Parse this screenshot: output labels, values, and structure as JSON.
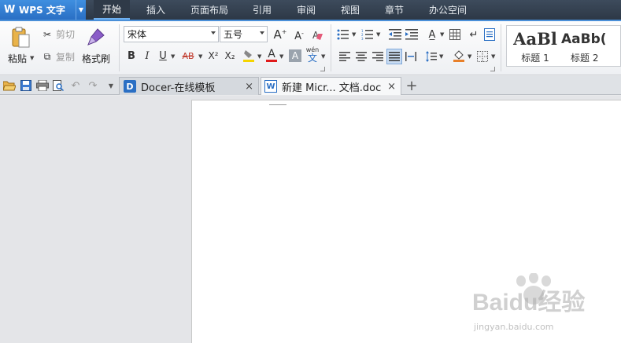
{
  "app": {
    "name": "WPS 文字"
  },
  "menu": {
    "tabs": [
      "开始",
      "插入",
      "页面布局",
      "引用",
      "审阅",
      "视图",
      "章节",
      "办公空间"
    ],
    "active": "开始"
  },
  "ribbon": {
    "paste": "粘贴",
    "cut": "剪切",
    "copy": "复制",
    "format_painter": "格式刷",
    "font_name": "宋体",
    "font_size": "五号",
    "bold": "B",
    "italic": "I",
    "underline": "U",
    "strikethrough": "AB",
    "superscript": "X²",
    "subscript": "X₂",
    "font_color": "A",
    "char_shading": "A",
    "phonetic": "wén",
    "grow_font": "A",
    "shrink_font": "A",
    "styles": [
      {
        "preview": "AaBl",
        "label": "标题 1"
      },
      {
        "preview": "AaBb(",
        "label": "标题 2"
      }
    ]
  },
  "tabs": {
    "docer": "Docer-在线模板",
    "document": "新建 Micr... 文档.doc",
    "close": "×",
    "new": "+"
  },
  "watermark": {
    "brand": "Baidu经验",
    "url": "jingyan.baidu.com"
  },
  "colors": {
    "accent": "#2a6fc4",
    "titlebar": "#2d3846",
    "ribbon_bg": "#eef0f3"
  }
}
